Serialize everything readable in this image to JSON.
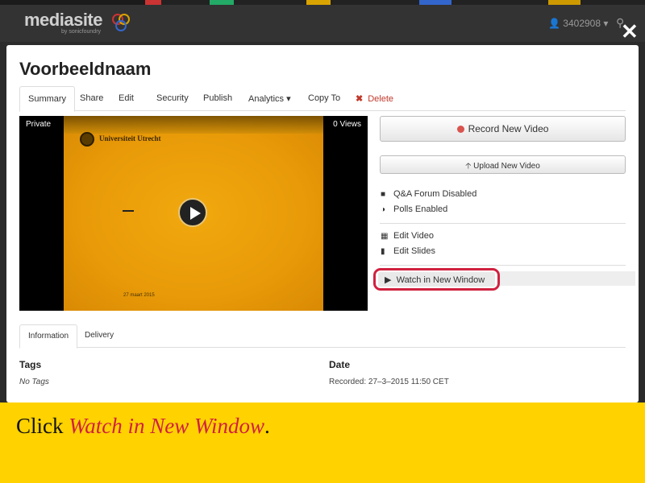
{
  "header": {
    "logo": "mediasite",
    "logo_sub": "by sonicfoundry",
    "user": "3402908 ▾",
    "search_icon": "search-icon",
    "close_icon": "close-icon"
  },
  "modal": {
    "title": "Voorbeeldnaam",
    "tabs": [
      {
        "label": "Summary"
      },
      {
        "label": "Share"
      },
      {
        "label": "Edit"
      },
      {
        "label": "Security"
      },
      {
        "label": "Publish"
      },
      {
        "label": "Analytics ▾"
      },
      {
        "label": "Copy To"
      },
      {
        "label": "Delete"
      }
    ]
  },
  "player": {
    "visibility": "Private",
    "views": "0 Views",
    "slide_org": "Universiteit Utrecht",
    "slide_dash": "–",
    "slide_date": "27 maart 2015"
  },
  "actions": {
    "record": "Record New Video",
    "upload": "Upload New Video",
    "qa": "Q&A Forum Disabled",
    "polls": "Polls Enabled",
    "edit_video": "Edit Video",
    "edit_slides": "Edit Slides",
    "watch": "Watch in New Window"
  },
  "details": {
    "tabs": [
      {
        "label": "Information"
      },
      {
        "label": "Delivery"
      }
    ],
    "tags_label": "Tags",
    "tags_value": "No Tags",
    "date_label": "Date",
    "date_value": "Recorded: 27–3–2015 11:50 CET"
  },
  "instruction": {
    "prefix": "Click ",
    "target": "Watch in New Window",
    "suffix": "."
  },
  "colors": {
    "accent": "#d0213f",
    "banner": "#ffd200",
    "slide": "#e89a08"
  }
}
